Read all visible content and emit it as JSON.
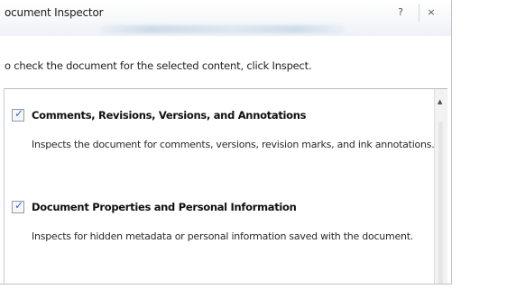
{
  "dialog": {
    "title": "ocument Inspector",
    "help_button": "?",
    "close_button": "×"
  },
  "instruction": "o check the document for the selected content, click Inspect.",
  "items": [
    {
      "checked": true,
      "check_glyph": "✓",
      "title": "Comments, Revisions, Versions, and Annotations",
      "description": "Inspects the document for comments, versions, revision marks, and ink annotations."
    },
    {
      "checked": true,
      "check_glyph": "✓",
      "title": "Document Properties and Personal Information",
      "description": "Inspects for hidden metadata or personal information saved with the document."
    }
  ],
  "scrollbar": {
    "up_arrow": "▲"
  },
  "colors": {
    "check": "#3a6bc6",
    "panel_border": "#b6bcc4",
    "title_bar": "#f6f8fa"
  }
}
